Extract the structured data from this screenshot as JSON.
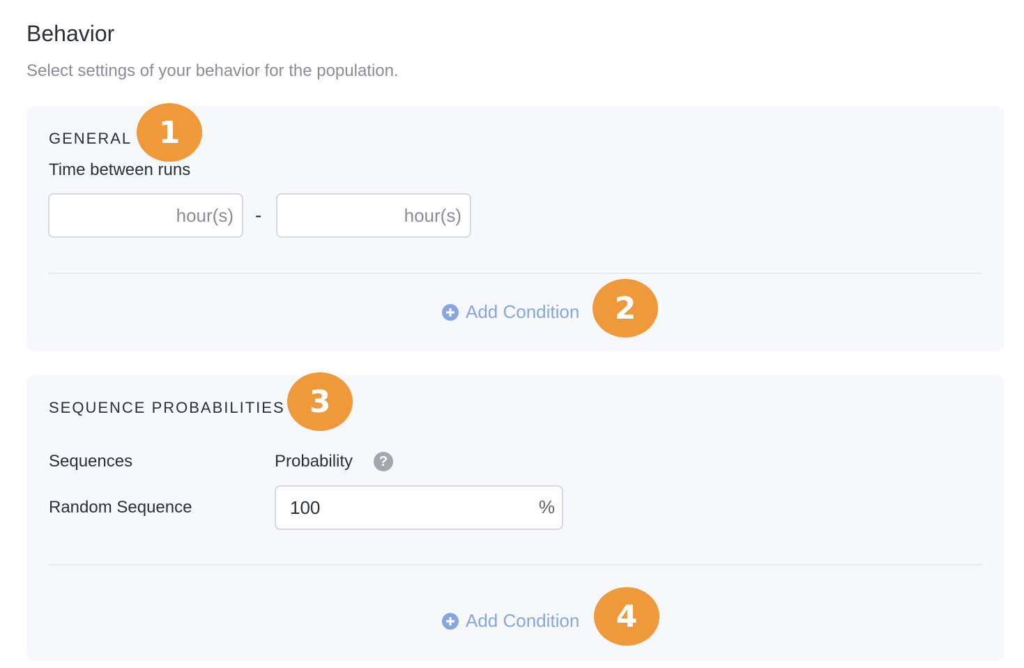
{
  "header": {
    "title": "Behavior",
    "subtitle": "Select settings of your behavior for the population."
  },
  "general": {
    "heading": "GENERAL",
    "badge": "1",
    "time_label": "Time between runs",
    "min_placeholder": "hour(s)",
    "separator": "-",
    "max_placeholder": "hour(s)",
    "add_condition_label": "Add Condition",
    "add_condition_badge": "2"
  },
  "sequence_probabilities": {
    "heading": "SEQUENCE PROBABILITIES",
    "badge": "3",
    "col_sequences": "Sequences",
    "col_probability": "Probability",
    "help_glyph": "?",
    "rows": [
      {
        "sequence": "Random Sequence",
        "probability": "100",
        "suffix": "%"
      }
    ],
    "add_condition_label": "Add Condition",
    "add_condition_badge": "4"
  },
  "colors": {
    "badge": "#f0993a",
    "link": "#86a6e0",
    "panel_bg": "#f7f8fb",
    "muted_text": "#8a8d93"
  },
  "icons": {
    "add": "plus-circle-icon",
    "help": "question-circle-icon"
  }
}
